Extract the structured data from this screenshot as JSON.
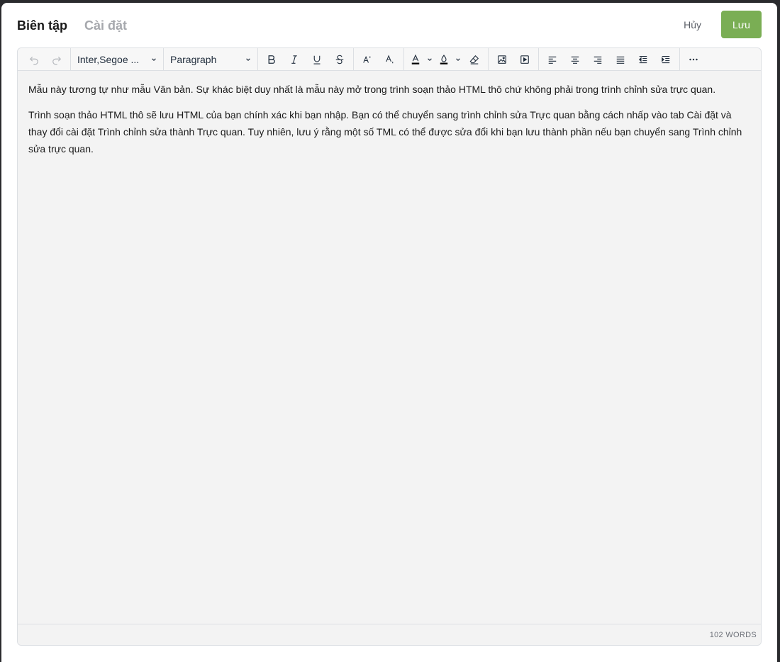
{
  "tabs": [
    {
      "label": "Biên tập",
      "active": true
    },
    {
      "label": "Cài đặt",
      "active": false
    }
  ],
  "actions": {
    "cancel_label": "Hủy",
    "save_label": "Lưu",
    "save_color": "#7aae54"
  },
  "toolbar": {
    "font_family": "Inter,Segoe ...",
    "block_format": "Paragraph",
    "icons": [
      "undo-icon",
      "redo-icon",
      "bold-icon",
      "italic-icon",
      "underline-icon",
      "strikethrough-icon",
      "superscript-icon",
      "subscript-icon",
      "text-color-icon",
      "highlight-color-icon",
      "clear-formatting-icon",
      "image-icon",
      "media-icon",
      "align-left-icon",
      "align-center-icon",
      "align-right-icon",
      "align-justify-icon",
      "outdent-icon",
      "indent-icon",
      "more-icon"
    ]
  },
  "content": {
    "paragraphs": [
      "Mẫu này tương tự như mẫu Văn bản. Sự khác biệt duy nhất là mẫu này mở trong trình soạn thảo HTML thô chứ không phải trong trình chỉnh sửa trực quan.",
      "Trình soạn thảo HTML thô sẽ lưu HTML của bạn chính xác khi bạn nhập. Bạn có thể chuyển sang trình chỉnh sửa Trực quan bằng cách nhấp vào tab Cài đặt và thay đổi cài đặt Trình chỉnh sửa thành Trực quan. Tuy nhiên, lưu ý rằng một số TML có thể được sửa đổi khi bạn lưu thành phần nếu bạn chuyển sang Trình chỉnh sửa trực quan."
    ]
  },
  "status": {
    "word_count": "102 WORDS"
  }
}
